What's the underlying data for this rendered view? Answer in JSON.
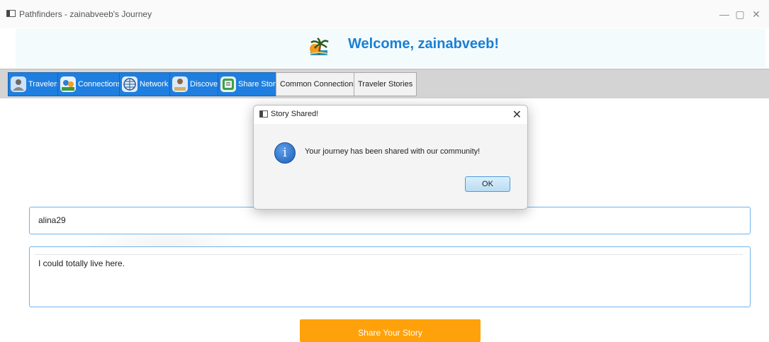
{
  "window": {
    "title": "Pathfinders - zainabveeb's Journey",
    "controls": {
      "minimize": "—",
      "maximize": "▢",
      "close": "✕"
    }
  },
  "header": {
    "welcome": "Welcome, zainabveeb!",
    "logo_icon": "palm-tree-icon"
  },
  "tabs": [
    {
      "label": "Travelers",
      "icon": "traveler-icon",
      "style": "blue"
    },
    {
      "label": "Connections",
      "icon": "connections-icon",
      "style": "blue"
    },
    {
      "label": "Network",
      "icon": "network-icon",
      "style": "blue"
    },
    {
      "label": "Discover",
      "icon": "discover-icon",
      "style": "blue"
    },
    {
      "label": "Share Story",
      "icon": "share-story-icon",
      "style": "blue"
    },
    {
      "label": "Common Connections",
      "style": "plain"
    },
    {
      "label": "Traveler Stories",
      "style": "plain"
    }
  ],
  "form": {
    "username_value": "alina29",
    "story_value": "I could totally live here.",
    "share_button": "Share Your Story"
  },
  "dialog": {
    "title": "Story Shared!",
    "message": "Your journey has been shared with our community!",
    "ok_label": "OK",
    "close": "✕",
    "info_glyph": "i"
  },
  "colors": {
    "accent_blue": "#1e7fe0",
    "welcome_text": "#1a7fd4",
    "share_button": "#ffa10a",
    "field_border": "#6fb4ec"
  }
}
